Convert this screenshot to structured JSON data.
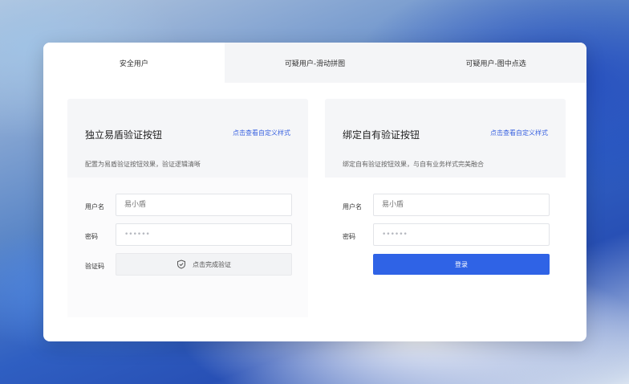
{
  "tabs": [
    {
      "label": "安全用户",
      "active": true
    },
    {
      "label": "可疑用户-滑动拼图",
      "active": false
    },
    {
      "label": "可疑用户-图中点选",
      "active": false
    }
  ],
  "left_panel": {
    "title": "独立易盾验证按钮",
    "link": "点击查看自定义样式",
    "description": "配置为易盾验证按钮效果，验证逻辑清晰",
    "username_label": "用户名",
    "username_placeholder": "易小盾",
    "password_label": "密码",
    "password_value": "••••••",
    "captcha_label": "验证码",
    "captcha_button": "点击完成验证",
    "captcha_icon": "shield-icon"
  },
  "right_panel": {
    "title": "绑定自有验证按钮",
    "link": "点击查看自定义样式",
    "description": "绑定自有验证按钮效果，与自有业务样式完美融合",
    "username_label": "用户名",
    "username_placeholder": "易小盾",
    "password_label": "密码",
    "password_value": "••••••",
    "login_button": "登录"
  },
  "colors": {
    "accent": "#2f63e6",
    "link": "#3a63e0",
    "tab_bg": "#f4f5f7",
    "panel_bg": "#f5f6f8"
  }
}
